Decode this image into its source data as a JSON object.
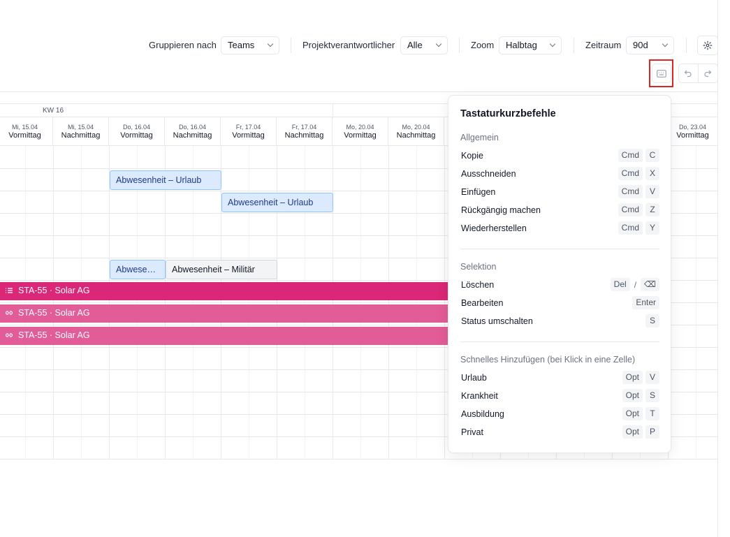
{
  "toolbar": {
    "group_by_label": "Gruppieren nach",
    "group_by_value": "Teams",
    "owner_label": "Projektverantwortlicher",
    "owner_value": "Alle",
    "zoom_label": "Zoom",
    "zoom_value": "Halbtag",
    "range_label": "Zeitraum",
    "range_value": "90d"
  },
  "calendar": {
    "week_label": "KW 16",
    "columns": [
      {
        "date": "Mi, 15.04",
        "part": "Vormittag"
      },
      {
        "date": "Mi, 15.04",
        "part": "Nachmittag"
      },
      {
        "date": "Do, 16.04",
        "part": "Vormittag"
      },
      {
        "date": "Do, 16.04",
        "part": "Nachmittag"
      },
      {
        "date": "Fr, 17.04",
        "part": "Vormittag"
      },
      {
        "date": "Fr, 17.04",
        "part": "Nachmittag"
      },
      {
        "date": "Mo, 20.04",
        "part": "Vormittag"
      },
      {
        "date": "Mo, 20.04",
        "part": "Nachmittag"
      },
      {
        "date": "",
        "part": ""
      },
      {
        "date": "",
        "part": ""
      },
      {
        "date": "",
        "part": ""
      },
      {
        "date": "",
        "part": ""
      },
      {
        "date": "Do, 23.04",
        "part": "Vormittag"
      }
    ],
    "events": {
      "vacation_1": "Abwesenheit – Urlaub",
      "vacation_2": "Abwesenheit – Urlaub",
      "absence_short": "Abwesenheit – Urlaub",
      "military": "Abwesenheit – Militär"
    },
    "bars": [
      {
        "label": "STA-55 · Solar AG",
        "icon": "list-icon"
      },
      {
        "label": "STA-55 · Solar AG",
        "icon": "link-icon"
      },
      {
        "label": "STA-55 · Solar AG",
        "icon": "link-icon"
      }
    ]
  },
  "shortcuts": {
    "title": "Tastaturkurzbefehle",
    "general": {
      "title": "Allgemein",
      "items": [
        {
          "label": "Kopie",
          "keys": [
            "Cmd",
            "C"
          ]
        },
        {
          "label": "Ausschneiden",
          "keys": [
            "Cmd",
            "X"
          ]
        },
        {
          "label": "Einfügen",
          "keys": [
            "Cmd",
            "V"
          ]
        },
        {
          "label": "Rückgängig machen",
          "keys": [
            "Cmd",
            "Z"
          ]
        },
        {
          "label": "Wiederherstellen",
          "keys": [
            "Cmd",
            "Y"
          ]
        }
      ]
    },
    "selection": {
      "title": "Selektion",
      "delete_label": "Löschen",
      "delete_key": "Del",
      "delete_sep": "/",
      "delete_alt_key": "⌫",
      "edit_label": "Bearbeiten",
      "edit_key": "Enter",
      "status_label": "Status umschalten",
      "status_key": "S"
    },
    "quick_add": {
      "title": "Schnelles Hinzufügen (bei Klick in eine Zelle)",
      "items": [
        {
          "label": "Urlaub",
          "keys": [
            "Opt",
            "V"
          ]
        },
        {
          "label": "Krankheit",
          "keys": [
            "Opt",
            "S"
          ]
        },
        {
          "label": "Ausbildung",
          "keys": [
            "Opt",
            "T"
          ]
        },
        {
          "label": "Privat",
          "keys": [
            "Opt",
            "P"
          ]
        }
      ]
    }
  },
  "colors": {
    "project_primary": "#db2777",
    "project_secondary": "#e25c97",
    "vacation_bg": "#dbeafe",
    "highlight": "#dc2626"
  }
}
